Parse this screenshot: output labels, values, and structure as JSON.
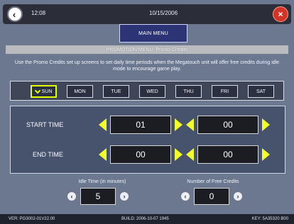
{
  "topbar": {
    "time": "12:08",
    "date": "10/15/2006"
  },
  "menu": {
    "main_label": "MAIN MENU"
  },
  "screen_title": "PROMOTION MENU: Promo Credits",
  "description": "Use the Promo Credits set up screens to set daily time periods when the Megatouch unit will offer free credits during idle mode to encourage game play.",
  "days": [
    "SUN",
    "MON",
    "TUE",
    "WED",
    "THU",
    "FRI",
    "SAT"
  ],
  "selected_day": "SUN",
  "start_time": {
    "label": "START TIME",
    "hour": "01",
    "minute": "00"
  },
  "end_time": {
    "label": "END TIME",
    "hour": "00",
    "minute": "00"
  },
  "idle_time": {
    "label": "Idle Time (in minutes)",
    "value": "5"
  },
  "free_credits": {
    "label": "Number of Free Credits",
    "value": "0"
  },
  "footer": {
    "version": "VER: PG3002-01V22.00",
    "build": "BUILD: 2006-10-07 1945",
    "key": "KEY: 5A35320 B00"
  },
  "colors": {
    "accent": "#f3ff2c",
    "close": "#d23427",
    "background": "#6b7890"
  },
  "icons": {
    "back": "back-icon",
    "close": "close-icon"
  }
}
